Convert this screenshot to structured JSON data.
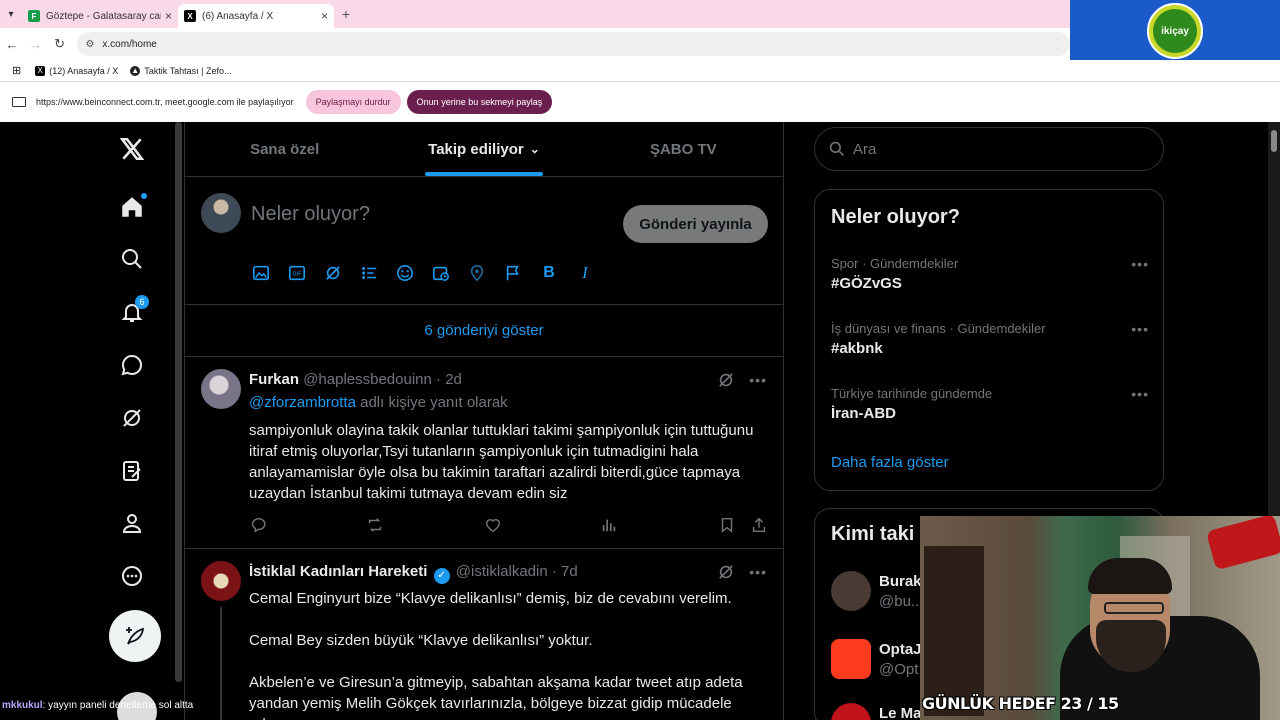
{
  "browser": {
    "tabs": [
      {
        "title": "Göztepe - Galatasaray canlı skor",
        "favicon_color": "#1a9d4a",
        "active": false
      },
      {
        "title": "(6) Anasayfa / X",
        "favicon_color": "#000000",
        "active": true
      }
    ],
    "url": "x.com/home",
    "bookmarks": [
      {
        "label": "(12) Anasayfa / X"
      },
      {
        "label": "Taktik Tahtası | Zefo..."
      }
    ],
    "share_notice": "https://www.beinconnect.com.tr, meet.google.com ile paylaşılıyor",
    "stop_sharing_label": "Paylaşmayı durdur",
    "share_this_tab_label": "Onun yerine bu sekmeyi paylaş"
  },
  "overlay_logo": {
    "text": "ikiçay"
  },
  "nav": {
    "notification_count": "6"
  },
  "feed": {
    "tabs": [
      {
        "label": "Sana özel",
        "active": false
      },
      {
        "label": "Takip ediliyor",
        "active": true
      },
      {
        "label": "ŞABO TV",
        "active": false
      }
    ],
    "composer_placeholder": "Neler oluyor?",
    "post_button": "Gönderi yayınla",
    "show_new": "6 gönderiyi göster",
    "tweets": [
      {
        "name": "Furkan",
        "handle": "@haplessbedouinn",
        "time": "2d",
        "reply_mention": "@zforzambrotta",
        "reply_suffix": "adlı kişiye yanıt olarak",
        "body": "sampiyonluk olayina takik olanlar tuttuklari takimi şampiyonluk için tuttuğunu itiraf etmiş oluyorlar,Tsyi tutanların şampiyonluk için tutmadigini hala anlayamamislar öyle olsa bu takimin taraftari azalirdi biterdi,güce tapmaya uzaydan İstanbul takimi tutmaya devam edin siz"
      },
      {
        "name": "İstiklal Kadınları Hareketi",
        "handle": "@istiklalkadin",
        "time": "7d",
        "verified": true,
        "body": "Cemal Enginyurt bize “Klavye delikanlısı” demiş, biz de cevabını verelim.\n\nCemal Bey sizden büyük “Klavye delikanlısı” yoktur.\n\nAkbelen’e ve Giresun’a gitmeyip, sabahtan akşama kadar tweet atıp adeta yandan yemiş Melih Gökçek tavırlarınızla, bölgeye bizzat gidip mücadele eden"
      }
    ]
  },
  "sidebar": {
    "search_placeholder": "Ara",
    "trends_title": "Neler oluyor?",
    "trends": [
      {
        "meta": "Spor · Gündemdekiler",
        "tag": "#GÖZvGS"
      },
      {
        "meta": "İş dünyası ve finans · Gündemdekiler",
        "tag": "#akbnk"
      },
      {
        "meta": "Türkiye tarihinde gündemde",
        "tag": "İran-ABD"
      }
    ],
    "show_more": "Daha fazla göster",
    "who_title": "Kimi taki",
    "who": [
      {
        "name": "Burak",
        "handle": "@bu..."
      },
      {
        "name": "OptaJ",
        "handle": "@Opt"
      },
      {
        "name": "Le Ma",
        "handle": ""
      }
    ]
  },
  "stream": {
    "goal_text": "GÜNLÜK HEDEF 23 / 15",
    "chat_user": "mkkukul",
    "chat_message": ": yayyın paneli denetleme sol altta"
  }
}
